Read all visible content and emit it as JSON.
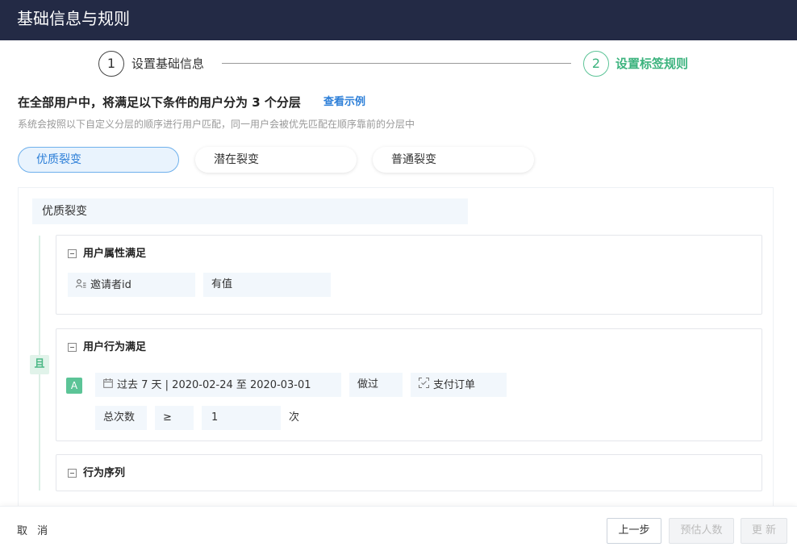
{
  "window": {
    "title": "基础信息与规则"
  },
  "steps": [
    {
      "number": "1",
      "label": "设置基础信息"
    },
    {
      "number": "2",
      "label": "设置标签规则"
    }
  ],
  "heading": "在全部用户中，将满足以下条件的用户分为 3 个分层",
  "example_link": "查看示例",
  "subtext": "系统会按照以下自定义分层的顺序进行用户匹配，同一用户会被优先匹配在顺序靠前的分层中",
  "tabs": [
    "优质裂变",
    "潜在裂变",
    "普通裂变"
  ],
  "group": {
    "name": "优质裂变",
    "logic_label": "且",
    "attribute_section": {
      "title": "用户属性满足",
      "field": "邀请者id",
      "field_icon": "user-attribute-icon",
      "operator": "有值"
    },
    "behavior_section": {
      "title": "用户行为满足",
      "rule_letter": "A",
      "date_icon": "calendar-icon",
      "date_range": "过去 7 天 | 2020-02-24 至 2020-03-01",
      "action": "做过",
      "event_icon": "event-icon",
      "event": "支付订单",
      "metric": "总次数",
      "comparator": "≥",
      "value": "1",
      "unit": "次"
    },
    "sequence_section": {
      "title": "行为序列"
    }
  },
  "footer": {
    "cancel": "取 消",
    "prev": "上一步",
    "estimate": "预估人数",
    "update": "更 新"
  },
  "colors": {
    "titlebar": "#232a45",
    "accent_green": "#3cb37e",
    "link_blue": "#2d7fd8",
    "chip_bg": "#f2f7fc"
  }
}
